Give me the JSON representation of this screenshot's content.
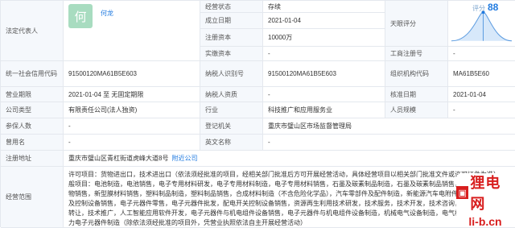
{
  "legal_rep": {
    "label": "法定代表人",
    "avatar_char": "何",
    "name": "何龙"
  },
  "status": {
    "label": "经营状态",
    "value": "存续"
  },
  "setup_date": {
    "label": "成立日期",
    "value": "2021-01-04"
  },
  "reg_capital": {
    "label": "注册资本",
    "value": "10000万"
  },
  "paid_capital": {
    "label": "实缴资本",
    "value": "-"
  },
  "tianyan": {
    "label": "天眼评分",
    "score_label": "评分",
    "score": "88"
  },
  "biz_reg_no": {
    "label": "工商注册号",
    "value": "-"
  },
  "credit_code": {
    "label": "统一社会信用代码",
    "value": "91500120MA61B5E603"
  },
  "taxpayer_id": {
    "label": "纳税人识别号",
    "value": "91500120MA61B5E603"
  },
  "org_code": {
    "label": "组织机构代码",
    "value": "MA61B5E60"
  },
  "term": {
    "label": "营业期限",
    "value": "2021-01-04 至 无固定期限"
  },
  "taxpayer_qual": {
    "label": "纳税人资质",
    "value": "-"
  },
  "approve_date": {
    "label": "核准日期",
    "value": "2021-01-04"
  },
  "company_type": {
    "label": "公司类型",
    "value": "有限责任公司(法人独资)"
  },
  "industry": {
    "label": "行业",
    "value": "科技推广和应用服务业"
  },
  "staff_size": {
    "label": "人员规模",
    "value": "-"
  },
  "insured": {
    "label": "参保人数",
    "value": "-"
  },
  "reg_authority": {
    "label": "登记机关",
    "value": "重庆市璧山区市场监督管理局"
  },
  "former_name": {
    "label": "曾用名",
    "value": "-"
  },
  "english_name": {
    "label": "英文名称",
    "value": "-"
  },
  "address": {
    "label": "注册地址",
    "value": "重庆市璧山区青杠街道虎峰大道8号",
    "link": "附近公司"
  },
  "scope": {
    "label": "经营范围",
    "value": "许可项目：货物进出口，技术进出口（依法须经批准的项目，经相关部门批准后方可开展经营活动，具体经营项目以相关部门批准文件或许可证件为准）一般项目：电池制造，电池销售，电子专用材料研发，电子专用材料制造，电子专用材料销售，石墨及碳素制品制造，石墨及碳素制品销售，高纯元素及化合物销售，新型膜材料销售，塑料制品制造，塑料制品销售，合成材料制造（不含危险化学品），汽车零部件及配件制造，新能源汽车电附件销售，智能输配电及控制设备销售，电子元器件零售，电子元器件批发，配电开关控制设备销售，资源再生利用技术研发，技术服务，技术开发，技术咨询，技术交流，技术转让，技术推广，人工智能应用软件开发，电子元器件与机电组件设备销售，电子元器件与机电组件设备制造，机械电气设备制造，电气机械设备销售，电力电子元器件制造（除依法须经批准的项目外，凭营业执照依法自主开展经营活动）"
  },
  "watermark": {
    "text": "狸电网",
    "url": "li-b.cn"
  },
  "colors": {
    "label_bg": "#f5f8fc",
    "border": "#e4e8ee",
    "link": "#1f7ae0",
    "brand": "#d81e1e"
  }
}
